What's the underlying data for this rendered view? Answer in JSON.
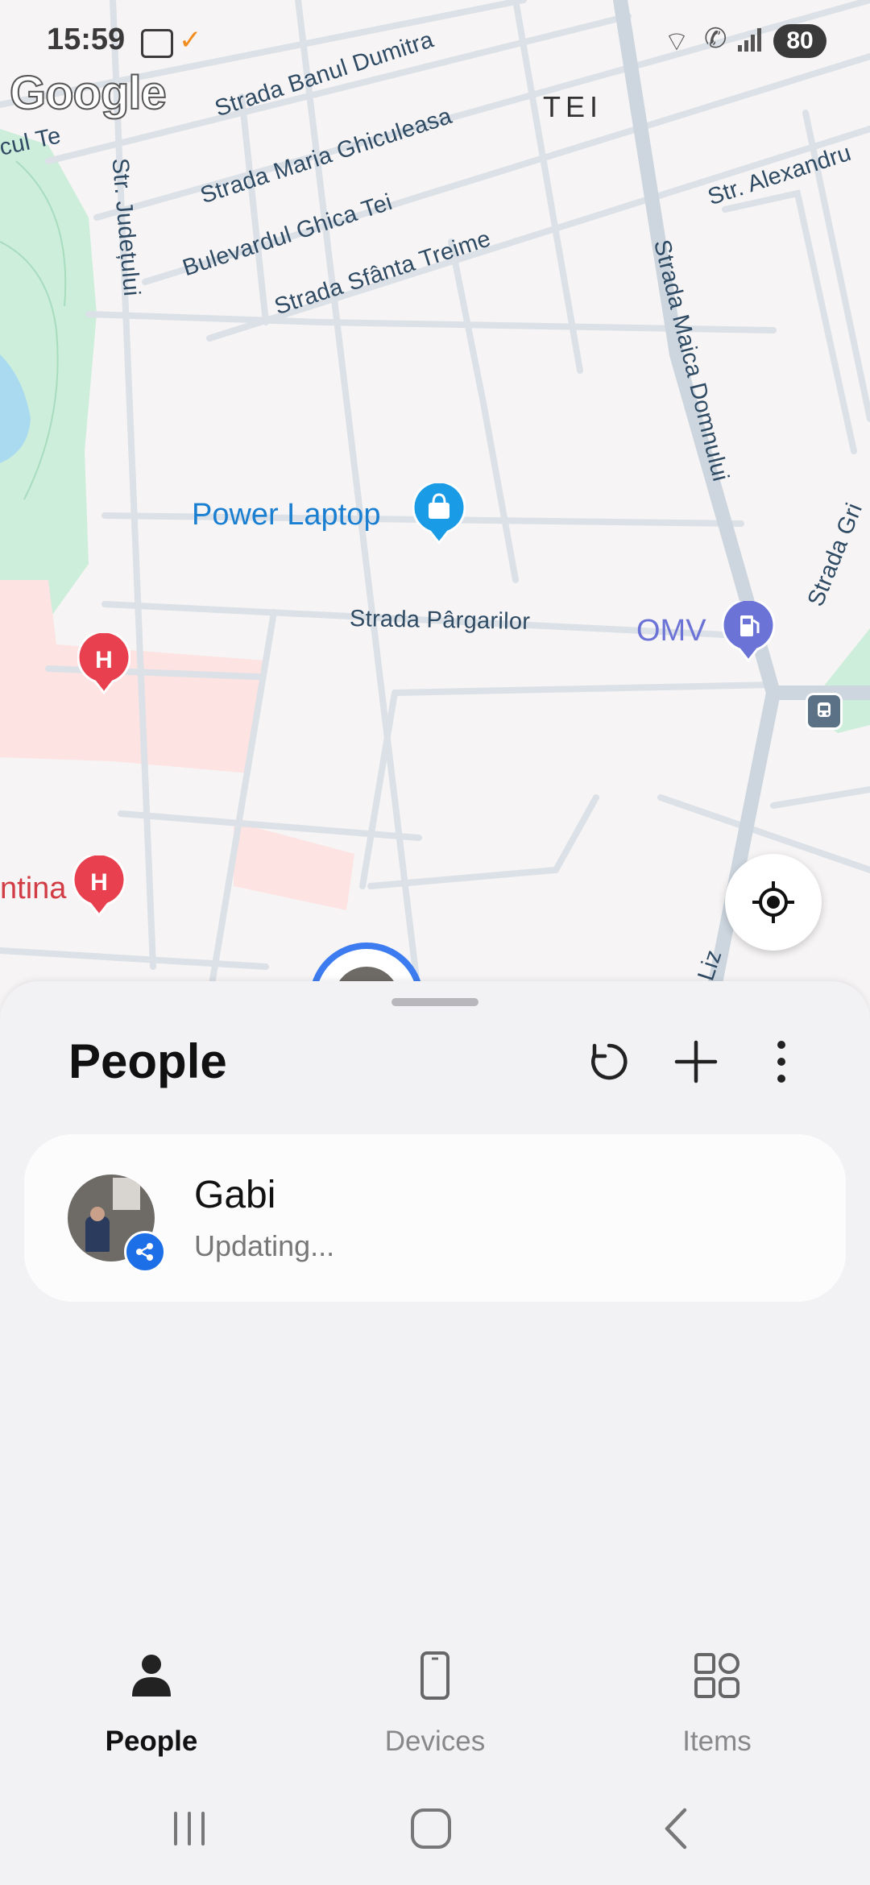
{
  "status_bar": {
    "time": "15:59",
    "battery": "80"
  },
  "map": {
    "attribution": "Google",
    "district": "TEI",
    "streets": {
      "banul": "Strada Banul Dumitra",
      "maria": "Strada Maria Ghiculeasa",
      "ghica": "Bulevardul Ghica Tei",
      "sfanta": "Strada Sfânta Treime",
      "judetului": "Str. Județului",
      "maica": "Strada Maica Domnului",
      "alexandru": "Str. Alexandru",
      "pargarilor": "Strada Pârgarilor",
      "grig": "Strada Gri",
      "lacul": "cul Te",
      "lizi": "Liz",
      "tina": "ntina"
    },
    "pois": {
      "power_laptop": "Power Laptop",
      "omv": "OMV"
    },
    "colors": {
      "park": "#cdeedb",
      "hospital_area": "#fde3e1",
      "water": "#a9daf0",
      "road": "#dbe1e7",
      "hospital_pin": "#e8404e",
      "shop_pin": "#1a9be6",
      "fuel_pin": "#6c73d6"
    }
  },
  "sheet": {
    "title": "People",
    "actions": {
      "refresh": "refresh-icon",
      "add": "plus-icon",
      "more": "more-vert-icon"
    },
    "people": [
      {
        "name": "Gabi",
        "status": "Updating..."
      }
    ]
  },
  "tabs": [
    {
      "label": "People",
      "icon": "person-icon",
      "active": true
    },
    {
      "label": "Devices",
      "icon": "phone-icon",
      "active": false
    },
    {
      "label": "Items",
      "icon": "grid-icon",
      "active": false
    }
  ]
}
